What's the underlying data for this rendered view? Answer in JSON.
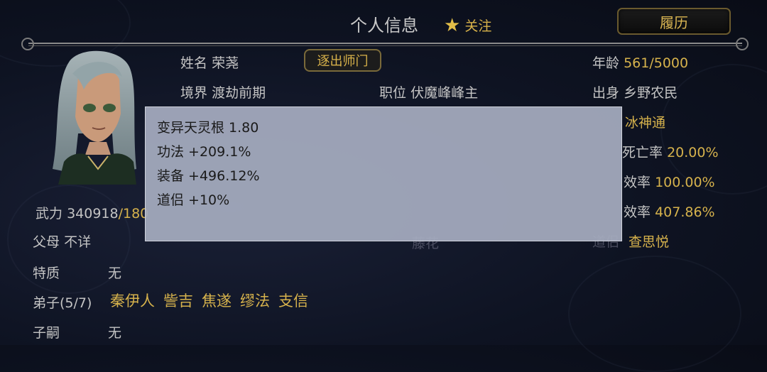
{
  "header": {
    "title": "个人信息",
    "follow_label": "关注",
    "resume_button": "履历"
  },
  "profile": {
    "name_label": "姓名",
    "name": "荣荛",
    "exile_button": "逐出师门",
    "age_label": "年龄",
    "age": "561",
    "age_max": "/5000",
    "realm_label": "境界",
    "realm": "渡劫前期",
    "position_label": "职位",
    "position": "伏魔峰峰主",
    "origin_label": "出身",
    "origin": "乡野农民",
    "skill_partial": "冰神通",
    "death_rate_label_partial": "死亡率",
    "death_rate": "20.00%",
    "efficiency_label_partial": "效率",
    "efficiency_a": "100.00%",
    "efficiency_b": "407.86%",
    "spouse": "查思悦",
    "bg_flower": "藤花",
    "bg_dao": "道侣",
    "combat_label": "武力",
    "combat_value": "340918",
    "combat_max_partial": "/180",
    "parents_label": "父母",
    "parents": "不详",
    "trait_label": "特质",
    "trait": "无",
    "disciples_label": "弟子(5/7)",
    "disciples": [
      "秦伊人",
      "訾吉",
      "焦遂",
      "缪法",
      "支信"
    ],
    "heir_label": "子嗣",
    "heir": "无"
  },
  "tooltip": {
    "lines": [
      "变异天灵根 1.80",
      "功法 +209.1%",
      "装备 +496.12%",
      "道侣 +10%"
    ]
  },
  "colors": {
    "gold": "#d6b24c",
    "background": "#0e1322",
    "tooltip_bg": "#a6acc0"
  },
  "icons": [
    "star-icon",
    "portrait-avatar"
  ]
}
